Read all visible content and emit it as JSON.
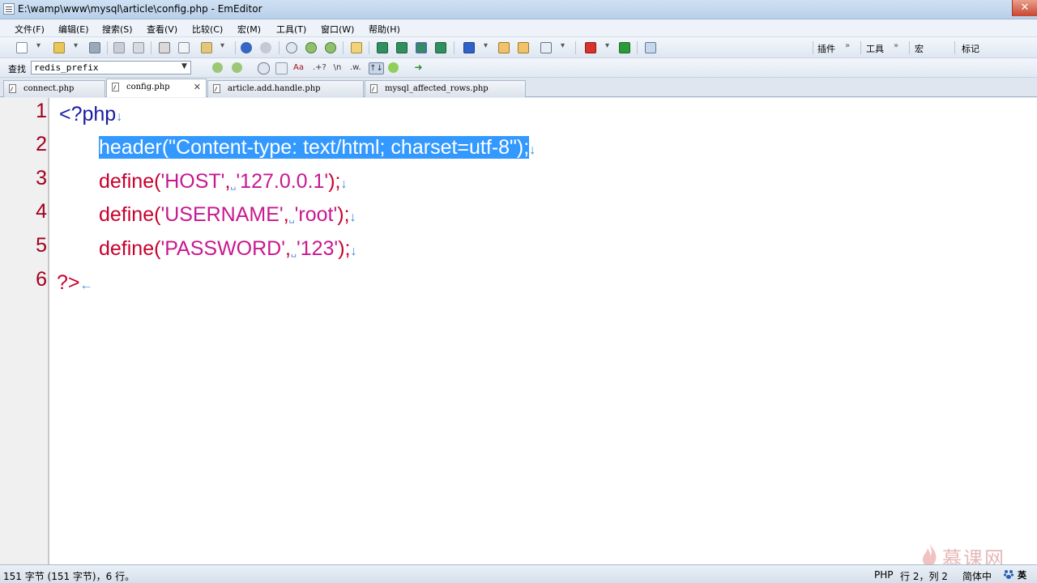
{
  "window": {
    "title": "E:\\wamp\\www\\mysql\\article\\config.php - EmEditor",
    "close_glyph": "✕"
  },
  "menu": [
    {
      "label": "文件(F)"
    },
    {
      "label": "编辑(E)"
    },
    {
      "label": "搜索(S)"
    },
    {
      "label": "查看(V)"
    },
    {
      "label": "比较(C)"
    },
    {
      "label": "宏(M)"
    },
    {
      "label": "工具(T)"
    },
    {
      "label": "窗口(W)"
    },
    {
      "label": "帮助(H)"
    }
  ],
  "toolbar": {
    "plugins_label": "插件",
    "tools_label": "工具",
    "macro_label": "宏",
    "marker_label": "标记",
    "overflow_glyph": "»"
  },
  "findbar": {
    "label": "查找",
    "value": "redis_prefix",
    "dropdown_glyph": "▼",
    "opt_case": "Aa",
    "opt_regex": ".+?",
    "opt_escape": "\\n",
    "opt_word": ".w.",
    "opt_updown": "↑↓"
  },
  "tabs": [
    {
      "label": "connect.php",
      "active": false
    },
    {
      "label": "config.php",
      "active": true,
      "close": "✕"
    },
    {
      "label": "article.add.handle.php",
      "active": false
    },
    {
      "label": "mysql_affected_rows.php",
      "active": false
    }
  ],
  "editor": {
    "line_numbers": [
      "1",
      "2",
      "3",
      "4",
      "5",
      "6"
    ],
    "line1": {
      "open_tag": "<?php",
      "eol": "↓"
    },
    "line2": {
      "text": "header(\"Content-type: text/html; charset=utf-8\");",
      "eol": "↓"
    },
    "line3": {
      "fn": "define(",
      "arg1": "'HOST'",
      "comma": ",",
      "space_mark": "␣",
      "arg2": "'127.0.0.1'",
      "close": ");",
      "eol": "↓"
    },
    "line4": {
      "fn": "define(",
      "arg1": "'USERNAME'",
      "comma": ",",
      "space_mark": "␣",
      "arg2": "'root'",
      "close": ");",
      "eol": "↓"
    },
    "line5": {
      "fn": "define(",
      "arg1": "'PASSWORD'",
      "comma": ",",
      "space_mark": "␣",
      "arg2": "'123'",
      "close": ");",
      "eol": "↓"
    },
    "line6": {
      "close_tag": "?>",
      "eof": "←"
    },
    "colors": {
      "selection": "#3399ff",
      "function": "#c8002e",
      "string": "#c81890",
      "keyword": "#1a1aa6",
      "line_number": "#a0001e",
      "whitespace_mark": "#3c8ad8"
    }
  },
  "status": {
    "left": "151 字节 (151 字节)，6 行。",
    "language": "PHP",
    "position": "行 2，列 2",
    "encoding": "简体中",
    "ime": "英"
  },
  "watermark": {
    "text": "慕课网"
  }
}
